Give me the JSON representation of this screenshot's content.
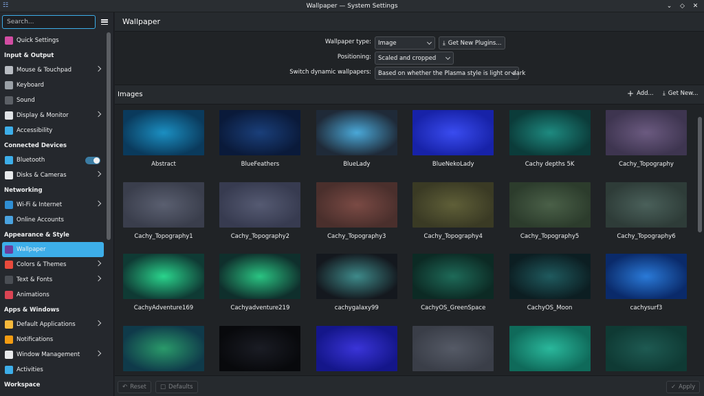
{
  "window": {
    "title": "Wallpaper — System Settings"
  },
  "search": {
    "placeholder": "Search..."
  },
  "sidebar": {
    "items": [
      {
        "type": "item",
        "label": "Quick Settings",
        "icon": "quick-settings-icon",
        "color": "#d24da3"
      },
      {
        "type": "section",
        "label": "Input & Output"
      },
      {
        "type": "item",
        "label": "Mouse & Touchpad",
        "icon": "mouse-icon",
        "color": "#b8bcc2",
        "chevron": true
      },
      {
        "type": "item",
        "label": "Keyboard",
        "icon": "keyboard-icon",
        "color": "#9aa0a6"
      },
      {
        "type": "item",
        "label": "Sound",
        "icon": "speaker-icon",
        "color": "#5c6066"
      },
      {
        "type": "item",
        "label": "Display & Monitor",
        "icon": "monitor-icon",
        "color": "#e0e3e6",
        "chevron": true
      },
      {
        "type": "item",
        "label": "Accessibility",
        "icon": "accessibility-icon",
        "color": "#3daee9"
      },
      {
        "type": "section",
        "label": "Connected Devices"
      },
      {
        "type": "item",
        "label": "Bluetooth",
        "icon": "bluetooth-icon",
        "color": "#3daee9",
        "toggle": true
      },
      {
        "type": "item",
        "label": "Disks & Cameras",
        "icon": "disk-icon",
        "color": "#e8eaec",
        "chevron": true
      },
      {
        "type": "section",
        "label": "Networking"
      },
      {
        "type": "item",
        "label": "Wi-Fi & Internet",
        "icon": "globe-icon",
        "color": "#2f8fd4",
        "chevron": true
      },
      {
        "type": "item",
        "label": "Online Accounts",
        "icon": "online-accounts-icon",
        "color": "#4aa3df"
      },
      {
        "type": "section",
        "label": "Appearance & Style"
      },
      {
        "type": "item",
        "label": "Wallpaper",
        "icon": "wallpaper-icon",
        "color": "#6b3fa0",
        "active": true
      },
      {
        "type": "item",
        "label": "Colors & Themes",
        "icon": "palette-icon",
        "color": "#e84a3c",
        "chevron": true
      },
      {
        "type": "item",
        "label": "Text & Fonts",
        "icon": "font-icon",
        "color": "#4a4e54",
        "chevron": true
      },
      {
        "type": "item",
        "label": "Animations",
        "icon": "animations-icon",
        "color": "#da4453"
      },
      {
        "type": "section",
        "label": "Apps & Windows"
      },
      {
        "type": "item",
        "label": "Default Applications",
        "icon": "star-icon",
        "color": "#f6b93b",
        "chevron": true
      },
      {
        "type": "item",
        "label": "Notifications",
        "icon": "bell-icon",
        "color": "#f39c12"
      },
      {
        "type": "item",
        "label": "Window Management",
        "icon": "window-icon",
        "color": "#e8eaec",
        "chevron": true
      },
      {
        "type": "item",
        "label": "Activities",
        "icon": "activities-icon",
        "color": "#3daee9"
      },
      {
        "type": "section",
        "label": "Workspace"
      }
    ]
  },
  "main": {
    "title": "Wallpaper",
    "options": {
      "wallpaper_type_label": "Wallpaper type:",
      "wallpaper_type_value": "Image",
      "get_plugins_label": "Get New Plugins...",
      "positioning_label": "Positioning:",
      "positioning_value": "Scaled and cropped",
      "dynamic_label": "Switch dynamic wallpapers:",
      "dynamic_value": "Based on whether the Plasma style is light or dark"
    },
    "images_title": "Images",
    "add_label": "Add...",
    "get_new_label": "Get New...",
    "wallpapers": [
      {
        "name": "Abstract",
        "c1": "#0a3a5c",
        "c2": "#1b8fc2"
      },
      {
        "name": "BlueFeathers",
        "c1": "#0a1a3a",
        "c2": "#1a3f7a"
      },
      {
        "name": "BlueLady",
        "c1": "#1f2a38",
        "c2": "#4aa8d8"
      },
      {
        "name": "BlueNekoLady",
        "c1": "#1722a8",
        "c2": "#3a4cf0"
      },
      {
        "name": "Cachy depths 5K",
        "c1": "#0b3c3a",
        "c2": "#1e8a80"
      },
      {
        "name": "Cachy_Topography",
        "c1": "#3e3550",
        "c2": "#6b5a80"
      },
      {
        "name": "Cachy_Topography1",
        "c1": "#3a3e4c",
        "c2": "#5a5f70"
      },
      {
        "name": "Cachy_Topography2",
        "c1": "#373b50",
        "c2": "#555a72"
      },
      {
        "name": "Cachy_Topography3",
        "c1": "#4a2f2c",
        "c2": "#7a4a44"
      },
      {
        "name": "Cachy_Topography4",
        "c1": "#3a3a24",
        "c2": "#5f5f38"
      },
      {
        "name": "Cachy_Topography5",
        "c1": "#2c3c2c",
        "c2": "#4a6048"
      },
      {
        "name": "Cachy_Topography6",
        "c1": "#2e3c38",
        "c2": "#4a605a"
      },
      {
        "name": "CachyAdventure169",
        "c1": "#0f3a34",
        "c2": "#2ad48c"
      },
      {
        "name": "Cachyadventure219",
        "c1": "#0f2f2c",
        "c2": "#2ac482"
      },
      {
        "name": "cachygalaxy99",
        "c1": "#14181e",
        "c2": "#3e8a8a"
      },
      {
        "name": "CachyOS_GreenSpace",
        "c1": "#0c2a24",
        "c2": "#1e6a58"
      },
      {
        "name": "CachyOS_Moon",
        "c1": "#0c1e22",
        "c2": "#1f5a5e"
      },
      {
        "name": "cachysurf3",
        "c1": "#0a2a6a",
        "c2": "#2a7ad8"
      },
      {
        "name": "",
        "c1": "#0f3a4a",
        "c2": "#2a9a6a"
      },
      {
        "name": "",
        "c1": "#08090c",
        "c2": "#1a1c24"
      },
      {
        "name": "",
        "c1": "#14168a",
        "c2": "#3a34d8"
      },
      {
        "name": "",
        "c1": "#3a3e48",
        "c2": "#555a66"
      },
      {
        "name": "",
        "c1": "#0f6a5a",
        "c2": "#2ab89c"
      },
      {
        "name": "",
        "c1": "#0f3a34",
        "c2": "#1e5a52"
      }
    ]
  },
  "footer": {
    "reset_label": "Reset",
    "defaults_label": "Defaults",
    "apply_label": "Apply"
  }
}
